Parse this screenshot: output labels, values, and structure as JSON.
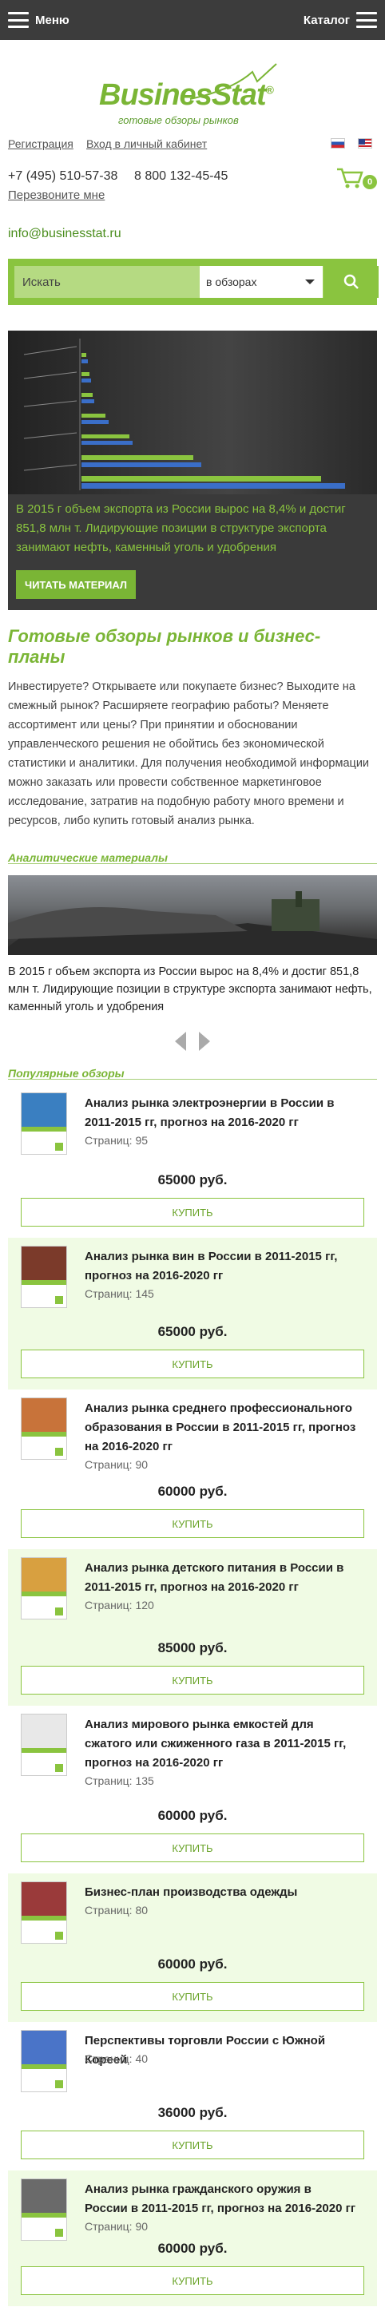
{
  "topbar": {
    "menu_label": "Меню",
    "catalog_label": "Каталог"
  },
  "logo": {
    "name": "BusinesStat",
    "reg": "®",
    "tagline": "готовые обзоры рынков"
  },
  "auth": {
    "register": "Регистрация",
    "login": "Вход в личный кабинет"
  },
  "contacts": {
    "phone1": "+7 (495) 510-57-38",
    "phone2": "8 800 132-45-45",
    "callback": "Перезвоните мне",
    "email": "info@businesstat.ru",
    "cart_count": "0"
  },
  "search": {
    "placeholder": "Искать",
    "scope": "в обзорах"
  },
  "banner": {
    "text": "В 2015 г объем экспорта из России вырос на 8,4% и достиг 851,8 млн т. Лидирующие позиции в структуре экспорта занимают нефть, каменный уголь и удобрения",
    "button": "ЧИТАТЬ МАТЕРИАЛ"
  },
  "main": {
    "title": "Готовые обзоры рынков и бизнес-планы",
    "intro": "Инвестируете? Открываете или покупаете бизнес? Выходите на смежный рынок? Расширяете географию работы? Меняете ассортимент или цены? При принятии и обосновании управленческого решения не обойтись без экономической статистики и аналитики. Для получения необходимой информации можно заказать или провести собственное маркетинговое исследование, затратив на подобную работу много времени и ресурсов, либо купить готовый анализ рынка."
  },
  "analytics": {
    "heading": "Аналитические материалы",
    "text": "В 2015 г объем экспорта из России вырос на 8,4% и достиг 851,8 млн т. Лидирующие позиции в структуре экспорта занимают нефть, каменный уголь и удобрения"
  },
  "popular": {
    "heading": "Популярные обзоры",
    "buy_label": "КУПИТЬ",
    "pages_prefix": "Страниц:",
    "items": [
      {
        "title": "Анализ рынка электроэнергии в России в 2011-2015 гг, прогноз на 2016-2020 гг",
        "pages": "Страниц: 95",
        "price": "65000 руб.",
        "cover_color": "#3a7fc1"
      },
      {
        "title": "Анализ рынка вин в России в 2011-2015 гг, прогноз на 2016-2020 гг",
        "pages": "Страниц: 145",
        "price": "65000 руб.",
        "cover_color": "#7b3a2a"
      },
      {
        "title": "Анализ рынка среднего профессионального образования в России в 2011-2015 гг, прогноз на 2016-2020 гг",
        "pages": "Страниц: 90",
        "price": "60000 руб.",
        "cover_color": "#c8733a"
      },
      {
        "title": "Анализ рынка детского питания в России в 2011-2015 гг, прогноз на 2016-2020 гг",
        "pages": "Страниц: 120",
        "price": "85000 руб.",
        "cover_color": "#d8a040"
      },
      {
        "title": "Анализ мирового рынка емкостей для сжатого или сжиженного газа в 2011-2015 гг, прогноз на 2016-2020 гг",
        "pages": "Страниц: 135",
        "price": "60000 руб.",
        "cover_color": "#e8e8e8"
      },
      {
        "title": "Бизнес-план производства одежды",
        "pages": "Страниц: 80",
        "price": "60000 руб.",
        "cover_color": "#9a3a3a"
      },
      {
        "title": "Перспективы торговли России с Южной Кореей",
        "pages": "Страниц: 40",
        "price": "36000 руб.",
        "cover_color": "#4a74c8"
      },
      {
        "title": "Анализ рынка гражданского оружия в России в 2011-2015 гг, прогноз на 2016-2020 гг",
        "pages": "Страниц: 90",
        "price": "60000 руб.",
        "cover_color": "#6a6a6a"
      }
    ]
  }
}
